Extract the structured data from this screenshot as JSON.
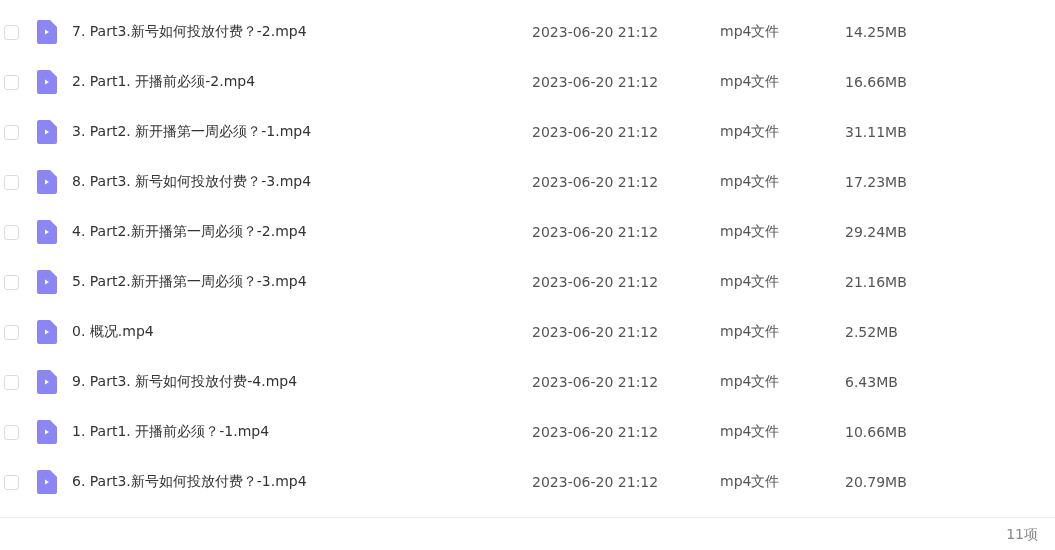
{
  "files": [
    {
      "name": "7. Part3.新号如何投放付费？-2.mp4",
      "modified": "2023-06-20 21:12",
      "type": "mp4文件",
      "size": "14.25MB",
      "checked": false
    },
    {
      "name": "2. Part1. 开播前必须-2.mp4",
      "modified": "2023-06-20 21:12",
      "type": "mp4文件",
      "size": "16.66MB",
      "checked": false
    },
    {
      "name": "3. Part2. 新开播第一周必须？-1.mp4",
      "modified": "2023-06-20 21:12",
      "type": "mp4文件",
      "size": "31.11MB",
      "checked": false
    },
    {
      "name": "8. Part3. 新号如何投放付费？-3.mp4",
      "modified": "2023-06-20 21:12",
      "type": "mp4文件",
      "size": "17.23MB",
      "checked": false
    },
    {
      "name": "4. Part2.新开播第一周必须？-2.mp4",
      "modified": "2023-06-20 21:12",
      "type": "mp4文件",
      "size": "29.24MB",
      "checked": false
    },
    {
      "name": "5. Part2.新开播第一周必须？-3.mp4",
      "modified": "2023-06-20 21:12",
      "type": "mp4文件",
      "size": "21.16MB",
      "checked": false
    },
    {
      "name": "0. 概况.mp4",
      "modified": "2023-06-20 21:12",
      "type": "mp4文件",
      "size": "2.52MB",
      "checked": false
    },
    {
      "name": "9. Part3. 新号如何投放付费-4.mp4",
      "modified": "2023-06-20 21:12",
      "type": "mp4文件",
      "size": "6.43MB",
      "checked": false
    },
    {
      "name": "1. Part1. 开播前必须？-1.mp4",
      "modified": "2023-06-20 21:12",
      "type": "mp4文件",
      "size": "10.66MB",
      "checked": false
    },
    {
      "name": "6. Part3.新号如何投放付费？-1.mp4",
      "modified": "2023-06-20 21:12",
      "type": "mp4文件",
      "size": "20.79MB",
      "checked": false
    }
  ],
  "footer": {
    "count": "11项"
  }
}
